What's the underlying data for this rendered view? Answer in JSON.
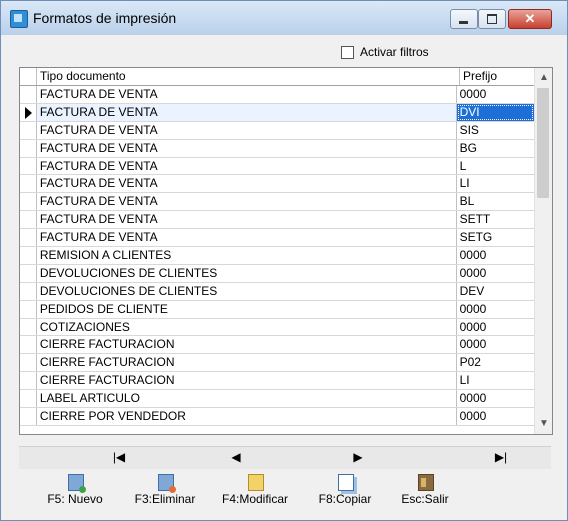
{
  "window": {
    "title": "Formatos de impresión"
  },
  "filter": {
    "label": "Activar filtros",
    "checked": false
  },
  "grid": {
    "columns": [
      "Tipo documento",
      "Prefijo"
    ],
    "rows": [
      {
        "tipo": "FACTURA DE VENTA",
        "prefijo": "0000"
      },
      {
        "tipo": "FACTURA DE VENTA",
        "prefijo": "DVI"
      },
      {
        "tipo": "FACTURA DE VENTA",
        "prefijo": "SIS"
      },
      {
        "tipo": "FACTURA DE VENTA",
        "prefijo": "BG"
      },
      {
        "tipo": "FACTURA DE VENTA",
        "prefijo": "L"
      },
      {
        "tipo": "FACTURA DE VENTA",
        "prefijo": "LI"
      },
      {
        "tipo": "FACTURA DE VENTA",
        "prefijo": "BL"
      },
      {
        "tipo": "FACTURA DE VENTA",
        "prefijo": "SETT"
      },
      {
        "tipo": "FACTURA DE VENTA",
        "prefijo": "SETG"
      },
      {
        "tipo": "REMISION A CLIENTES",
        "prefijo": "0000"
      },
      {
        "tipo": "DEVOLUCIONES DE CLIENTES",
        "prefijo": "0000"
      },
      {
        "tipo": "DEVOLUCIONES DE CLIENTES",
        "prefijo": "DEV"
      },
      {
        "tipo": "PEDIDOS DE CLIENTE",
        "prefijo": "0000"
      },
      {
        "tipo": "COTIZACIONES",
        "prefijo": "0000"
      },
      {
        "tipo": "CIERRE FACTURACION",
        "prefijo": "0000"
      },
      {
        "tipo": "CIERRE FACTURACION",
        "prefijo": "P02"
      },
      {
        "tipo": "CIERRE FACTURACION",
        "prefijo": "LI"
      },
      {
        "tipo": "LABEL ARTICULO",
        "prefijo": "0000"
      },
      {
        "tipo": "CIERRE POR VENDEDOR",
        "prefijo": "0000"
      }
    ]
  },
  "navigator": {
    "first": "|◀",
    "prev": "◀",
    "next": "▶",
    "last": "▶|"
  },
  "toolbar": {
    "nuevo": "F5: Nuevo",
    "eliminar": "F3:Eliminar",
    "modificar": "F4:Modificar",
    "copiar": "F8:Copiar",
    "salir": "Esc:Salir"
  }
}
